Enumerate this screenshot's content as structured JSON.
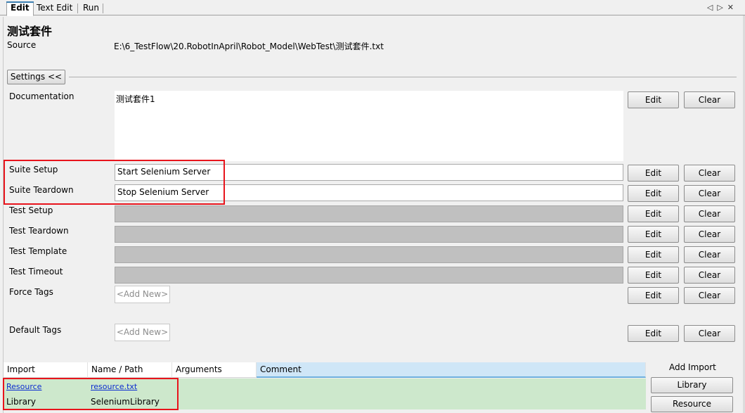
{
  "tabs": [
    {
      "label": "Edit",
      "active": true
    },
    {
      "label": "Text Edit",
      "active": false
    },
    {
      "label": "Run",
      "active": false
    }
  ],
  "nav_icons": [
    "prev-tab-icon",
    "next-tab-icon",
    "close-icon"
  ],
  "suite": {
    "title": "测试套件",
    "source_label": "Source",
    "source_value": "E:\\6_TestFlow\\20.RobotInApril\\Robot_Model\\WebTest\\测试套件.txt"
  },
  "settings_toggle": "Settings <<",
  "settings": {
    "documentation": {
      "label": "Documentation",
      "value": "测试套件1"
    },
    "rows": [
      {
        "label": "Suite Setup",
        "value": "Start Selenium Server",
        "enabled": true
      },
      {
        "label": "Suite Teardown",
        "value": "Stop Selenium Server",
        "enabled": true
      },
      {
        "label": "Test Setup",
        "value": "",
        "enabled": false
      },
      {
        "label": "Test Teardown",
        "value": "",
        "enabled": false
      },
      {
        "label": "Test Template",
        "value": "",
        "enabled": false
      },
      {
        "label": "Test Timeout",
        "value": "",
        "enabled": false
      }
    ],
    "force_tags": {
      "label": "Force Tags",
      "placeholder": "<Add New>"
    },
    "default_tags": {
      "label": "Default Tags",
      "placeholder": "<Add New>"
    },
    "edit_label": "Edit",
    "clear_label": "Clear"
  },
  "imports": {
    "columns": [
      "Import",
      "Name / Path",
      "Arguments",
      "Comment"
    ],
    "rows": [
      {
        "import": "Resource",
        "name": "resource.txt",
        "arguments": "",
        "comment": "",
        "link": true
      },
      {
        "import": "Library",
        "name": "SeleniumLibrary",
        "arguments": "",
        "comment": "",
        "link": false
      }
    ],
    "add_import_label": "Add Import",
    "buttons": [
      "Library",
      "Resource"
    ]
  },
  "colors": {
    "highlight": "#e8141c",
    "import_row_bg": "#cde8cc",
    "comment_header_bg": "#cfe6f7",
    "link": "#0b2bcf"
  }
}
